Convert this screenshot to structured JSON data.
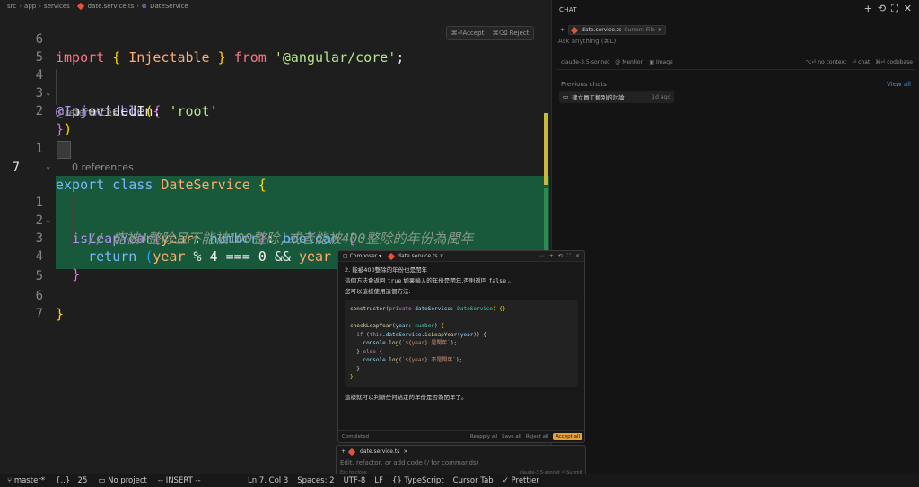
{
  "breadcrumb": {
    "parts": [
      "src",
      "app",
      "services",
      "date.service.ts",
      "DateService"
    ]
  },
  "editor": {
    "accept_label": "⌘⏎Accept",
    "reject_label": "⌘⌫ Reject",
    "lines": [
      {
        "num": "6",
        "text": "import { Injectable } from '@angular/core';"
      },
      {
        "num": "5",
        "text": ""
      },
      {
        "num": "4",
        "text": "@Injectable({"
      },
      {
        "num": "3",
        "text": "  providedIn: 'root'"
      },
      {
        "num": "2",
        "text": "})"
      },
      {
        "num": "1",
        "text": "export class DateService {"
      },
      {
        "num": "7",
        "text": ""
      },
      {
        "num": "1",
        "text": "  isLeapYear(year: number): boolean {"
      },
      {
        "num": "2",
        "text": "    // 能被4整除且不能被100整除,或者能被400整除的年份為閏年"
      },
      {
        "num": "3",
        "text": "    return (year % 4 === 0 && year % 100 !== 0) || (year % 400 ==="
      },
      {
        "num": "4",
        "text": "  }"
      },
      {
        "num": "5",
        "text": ""
      },
      {
        "num": "6",
        "text": "}"
      },
      {
        "num": "7",
        "text": ""
      }
    ],
    "codelens_class": "3 references",
    "codelens_method": "0 references"
  },
  "chat": {
    "title": "CHAT",
    "context_file": "date.service.ts",
    "context_tag": "Current File",
    "ask_placeholder": "Ask anything (⌘L)",
    "model": "claude-3.5-sonnet",
    "mention": "Mention",
    "image": "Image",
    "no_context": "⌥⏎ no context",
    "chat_btn": "⏎ chat",
    "codebase_btn": "⌘⏎ codebase",
    "previous_chats_label": "Previous chats",
    "view_all": "View all",
    "previous_chats": [
      {
        "title": "建立員工類別的討論",
        "ago": "1d ago"
      }
    ]
  },
  "composer": {
    "tab_composer": "Composer",
    "tab_file": "date.service.ts",
    "heading": "2. 能被400整除的年份也是閏年",
    "p1_pre": "這個方法會返回 ",
    "p1_true": "true",
    "p1_mid": " 如果輸入的年份是閏年,否則返回 ",
    "p1_false": "false",
    "p1_end": " 。",
    "p2": "您可以這樣使用這個方法:",
    "p3": "這樣就可以判斷任何給定的年份是否為閏年了。",
    "status": "Completed",
    "reapply": "Reapply all",
    "save_all": "Save all",
    "reject_all": "Reject all",
    "accept_all": "Accept all"
  },
  "cmdk": {
    "file": "date.service.ts",
    "placeholder": "Edit, refactor, or add code (/ for commands)",
    "esc": "Esc to close",
    "model": "claude-3.5-sonnet",
    "submit": "⏎ Submit"
  },
  "statusbar": {
    "branch": "master*",
    "symbols": "{..} : 25",
    "project": "No project",
    "mode": "-- INSERT --",
    "position": "Ln 7, Col 3",
    "spaces": "Spaces: 2",
    "encoding": "UTF-8",
    "eol": "LF",
    "language": "{} TypeScript",
    "cursor_tab": "Cursor Tab",
    "prettier": "✓ Prettier"
  }
}
